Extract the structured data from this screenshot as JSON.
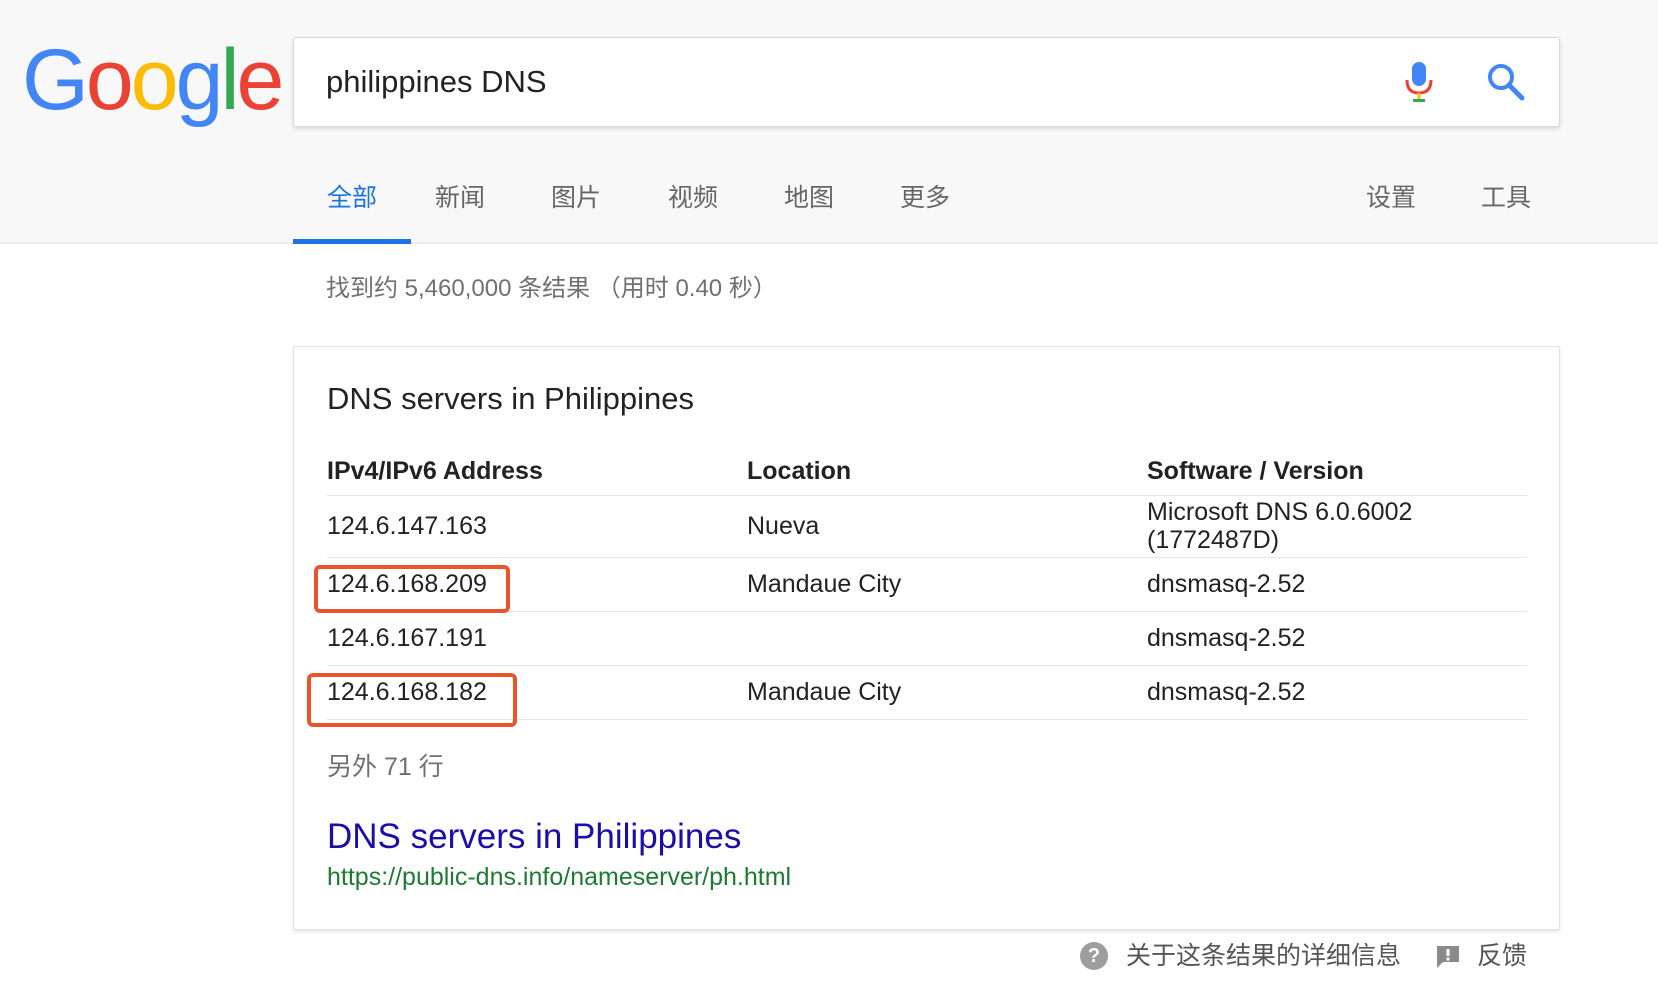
{
  "logo": {
    "letters": [
      "G",
      "o",
      "o",
      "g",
      "l",
      "e"
    ],
    "colors": [
      "#4285F4",
      "#EA4335",
      "#FBBC05",
      "#4285F4",
      "#34A853",
      "#EA4335"
    ]
  },
  "search": {
    "query": "philippines DNS"
  },
  "tabs": [
    {
      "label": "全部",
      "active": true
    },
    {
      "label": "新闻"
    },
    {
      "label": "图片"
    },
    {
      "label": "视频"
    },
    {
      "label": "地图"
    },
    {
      "label": "更多"
    },
    {
      "label": "设置"
    },
    {
      "label": "工具"
    }
  ],
  "stats": "找到约 5,460,000 条结果 （用时 0.40 秒）",
  "card": {
    "title": "DNS servers in Philippines",
    "headers": [
      "IPv4/IPv6 Address",
      "Location",
      "Software / Version"
    ],
    "rows": [
      {
        "ip": "124.6.147.163",
        "location": "Nueva",
        "software_line1": "Microsoft DNS 6.0.6002",
        "software_line2": "(1772487D)"
      },
      {
        "ip": "124.6.168.209",
        "location": "Mandaue City",
        "software_line1": "dnsmasq-2.52",
        "software_line2": ""
      },
      {
        "ip": "124.6.167.191",
        "location": "",
        "software_line1": "dnsmasq-2.52",
        "software_line2": ""
      },
      {
        "ip": "124.6.168.182",
        "location": "Mandaue City",
        "software_line1": "dnsmasq-2.52",
        "software_line2": ""
      }
    ],
    "more_rows": "另外 71 行",
    "link_title": "DNS servers in Philippines",
    "link_url": "https://public-dns.info/nameserver/ph.html"
  },
  "footer": {
    "about": "关于这条结果的详细信息",
    "feedback": "反馈"
  },
  "colors": {
    "accent": "#1a73e8",
    "link": "#1a0dab",
    "url": "#1e7b32",
    "highlight": "#e8542b"
  }
}
